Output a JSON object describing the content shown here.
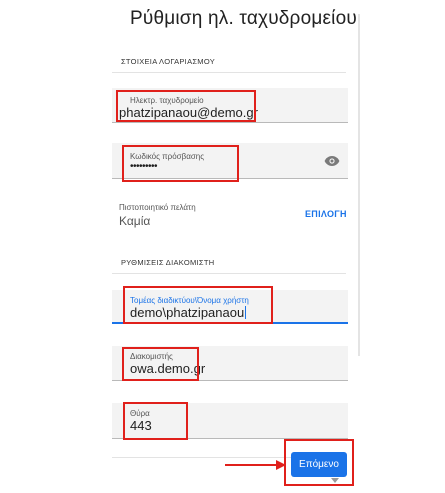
{
  "screen": {
    "title": "Ρύθμιση ηλ. ταχυδρομείου",
    "account_section": "ΣΤΟΙΧΕΙΑ ΛΟΓΑΡΙΑΣΜΟΥ",
    "server_section": "ΡΥΘΜΙΣΕΙΣ ΔΙΑΚΟΜΙΣΤΗ"
  },
  "fields": {
    "email": {
      "label": "Ηλεκτρ. ταχυδρομείο",
      "value": "phatzipanaou@demo.gr"
    },
    "password": {
      "label": "Κωδικός πρόσβασης",
      "value": "•••••••••",
      "icon": "eye-icon"
    },
    "certificate": {
      "label": "Πιστοποιητικό πελάτη",
      "value": "Καμία",
      "action": "ΕΠΙΛΟΓΗ"
    },
    "domain_user": {
      "label": "Τομέας διαδικτύου\\Όνομα χρήστη",
      "value": "demo\\phatzipanaou"
    },
    "server": {
      "label": "Διακομιστής",
      "value": "owa.demo.gr"
    },
    "port": {
      "label": "Θύρα",
      "value": "443"
    }
  },
  "next_button": {
    "label": "Επόμενο"
  },
  "colors": {
    "accent": "#1a73e8",
    "highlight": "#e0201b",
    "field_bg": "#f3f3f3"
  }
}
